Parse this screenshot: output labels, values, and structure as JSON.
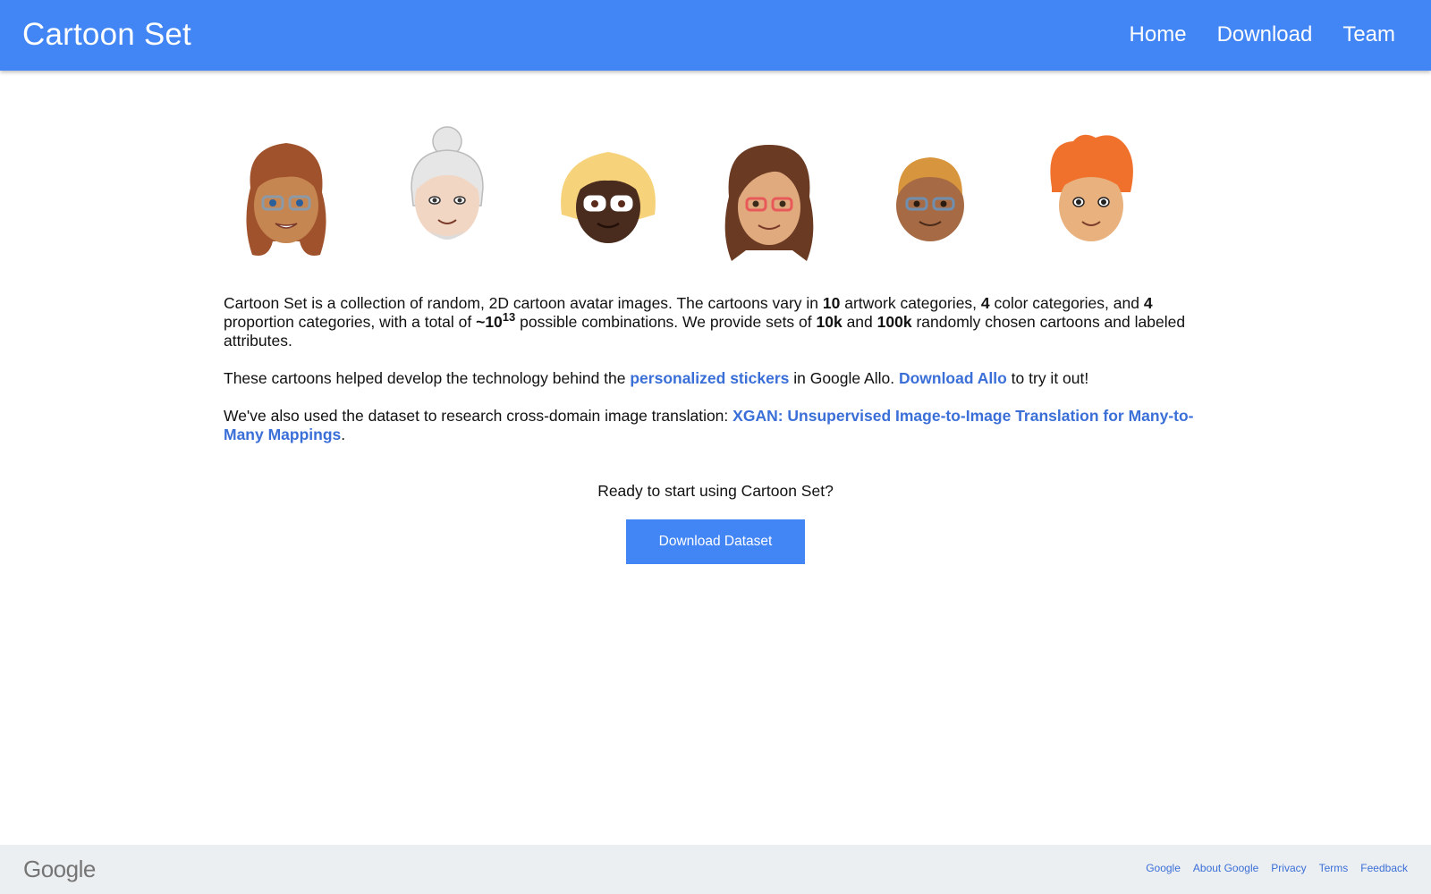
{
  "header": {
    "brand": "Cartoon Set",
    "nav": [
      "Home",
      "Download",
      "Team"
    ]
  },
  "avatars": [
    {
      "name": "avatar-auburn-wavy-hair",
      "hair": "#a0522d",
      "skin": "#c68651",
      "glasses": "#8a9aa8"
    },
    {
      "name": "avatar-gray-bun-hair",
      "hair": "#e6e6e6",
      "skin": "#f2d6c4",
      "glasses": "none"
    },
    {
      "name": "avatar-blonde-bob-hair",
      "hair": "#f6d27a",
      "skin": "#4a2c1f",
      "glasses": "#ffffff"
    },
    {
      "name": "avatar-brown-long-hair",
      "hair": "#6b3a23",
      "skin": "#e0aa7e",
      "glasses": "#e85a5a"
    },
    {
      "name": "avatar-short-hair",
      "hair": "#d7953d",
      "skin": "#a66b45",
      "glasses": "#6f8fb0"
    },
    {
      "name": "avatar-orange-curly-hair",
      "hair": "#f0712c",
      "skin": "#e8b17e",
      "glasses": "none"
    }
  ],
  "intro": {
    "p1a": "Cartoon Set is a collection of random, 2D cartoon avatar images. The cartoons vary in ",
    "n_artwork": "10",
    "p1b": " artwork categories, ",
    "n_color": "4",
    "p1c": " color categories, and ",
    "n_proportion": "4",
    "p1d": " proportion categories, with a total of ",
    "total_base": "~10",
    "total_exp": "13",
    "p1e": " possible combinations. We provide sets of ",
    "set_small": "10k",
    "p1f": " and ",
    "set_large": "100k",
    "p1g": " randomly chosen cartoons and labeled attributes.",
    "p2a": "These cartoons helped develop the technology behind the ",
    "p2_link1": "personalized stickers",
    "p2b": " in Google Allo. ",
    "p2_link2": "Download Allo",
    "p2c": " to try it out!",
    "p3a": "We've also used the dataset to research cross-domain image translation: ",
    "p3_link": "XGAN: Unsupervised Image-to-Image Translation for Many-to-Many Mappings",
    "p3b": "."
  },
  "cta": {
    "question": "Ready to start using Cartoon Set?",
    "button": "Download Dataset"
  },
  "footer": {
    "logo": "Google",
    "links": [
      "Google",
      "About Google",
      "Privacy",
      "Terms",
      "Feedback"
    ]
  }
}
